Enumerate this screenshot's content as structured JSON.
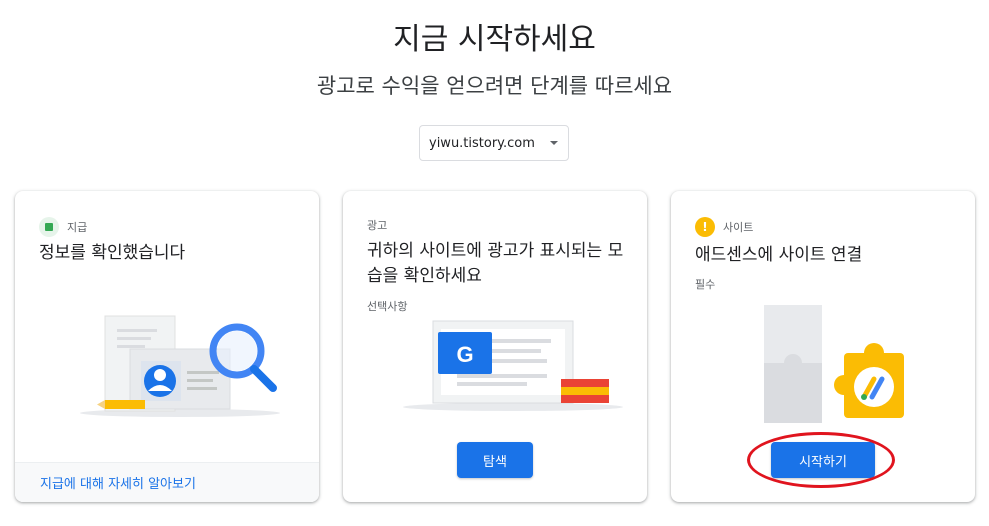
{
  "header": {
    "title": "지금 시작하세요",
    "subtitle": "광고로 수익을 얻으려면 단계를 따르세요"
  },
  "site_selector": {
    "value": "yiwu.tistory.com",
    "icon": "caret-down-icon"
  },
  "cards": [
    {
      "tag": "지급",
      "tag_icon": "green-check-square-icon",
      "title": "정보를 확인했습니다",
      "footer_link": "지급에 대해 자세히 알아보기"
    },
    {
      "tag": "광고",
      "title": "귀하의 사이트에 광고가 표시되는 모습을 확인하세요",
      "note": "선택사항",
      "button": "탐색",
      "illustration_letter": "G"
    },
    {
      "tag": "사이트",
      "tag_icon": "warning-exclamation-icon",
      "title": "애드센스에 사이트 연결",
      "note": "필수",
      "button": "시작하기",
      "tag_icon_glyph": "!"
    }
  ],
  "colors": {
    "primary": "#1a73e8",
    "success": "#34a853",
    "warning": "#fbbc04",
    "annotation": "#e0141e"
  }
}
